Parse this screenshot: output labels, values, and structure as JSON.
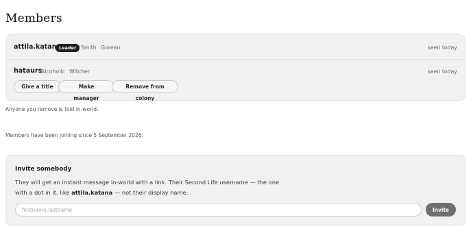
{
  "page": {
    "title": "Members"
  },
  "members": [
    {
      "username": "attila.katana",
      "badge": "Leader",
      "tags": [
        "Smith",
        "Gorean"
      ],
      "seen": "seen today"
    },
    {
      "username": "hataurs",
      "tags": [
        "Alcoholic",
        "Witcher"
      ],
      "seen": "seen today",
      "actions": [
        "Give a title",
        "Make manager",
        "Remove from colony"
      ]
    }
  ],
  "notes": {
    "remove_note": "Anyone you remove is told in-world.",
    "joining_note": "Members have been joining since 5 September 2026."
  },
  "invite": {
    "title": "Invite somebody",
    "desc_part1": "They will get an instant message in-world with a link. Their Second Life username — the one with a dot in it, like ",
    "desc_example": "attila.katana",
    "desc_part2": " — not their display name.",
    "placeholder": "firstname.lastname",
    "value": "",
    "button_label": "Invite"
  },
  "colors": {
    "badge_bg": "#1f1f1f",
    "card_bg": "#f1f1f1",
    "invite_button_bg": "#6f6f6f"
  }
}
